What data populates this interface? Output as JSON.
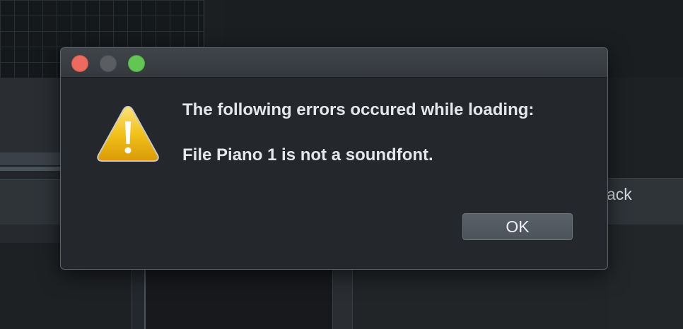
{
  "background": {
    "partial_label": "ack"
  },
  "dialog": {
    "title_buttons": [
      "close",
      "minimize",
      "maximize"
    ],
    "icon": "warning-icon",
    "message_heading": "The following errors occured while loading:",
    "message_detail": "File Piano 1 is not a soundfont.",
    "ok_label": "OK"
  },
  "colors": {
    "close": "#ed6a5e",
    "minimize": "#5a5e63",
    "maximize": "#62c554",
    "warning": "#f0c419",
    "dialog_bg": "#24282d"
  }
}
